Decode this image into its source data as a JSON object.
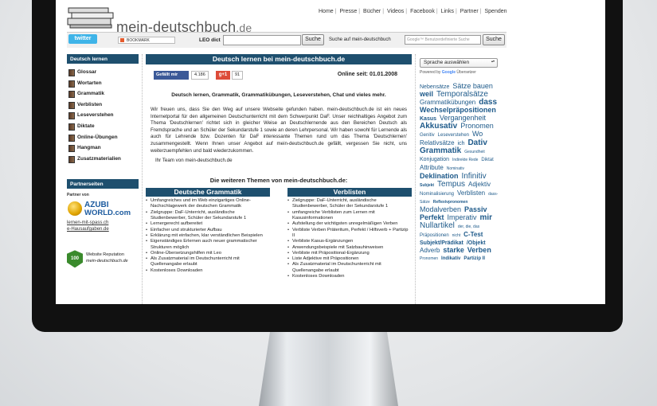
{
  "site": {
    "name": "mein-deutschbuch",
    "tld": ".de"
  },
  "topnav": [
    "Home",
    "Presse",
    "Bücher",
    "Videos",
    "Facebook",
    "Links",
    "Partner",
    "Spenden"
  ],
  "toolbar": {
    "twitter": "twitter",
    "bookmark": "BOOKMARK",
    "leo_label": "LEO dict",
    "search_button": "Suche",
    "site_search_label": "Suche auf mein-deutschbuch",
    "google_placeholder": "Google™ Benutzerdefinierte Suche",
    "search_button2": "Suche"
  },
  "sidebar": {
    "header": "Deutsch lernen",
    "items": [
      "Glossar",
      "Wortarten",
      "Grammatik",
      "Verblisten",
      "Leseverstehen",
      "Diktate",
      "Online-Übungen",
      "Hangman",
      "Zusatzmaterialien"
    ],
    "partner_header": "Partnerseiten",
    "partner_label": "Partner von",
    "azubi_line1": "AZUBI",
    "azubi_line2": "WORLD.com",
    "links": [
      "lernen-mit-spass.ch",
      "e-Hausaufgaben.de"
    ],
    "rep_badge": "100",
    "rep_line1": "Website Reputation",
    "rep_line2": "mein-deutschbuch.de"
  },
  "main": {
    "title": "Deutsch lernen bei mein-deutschbuch.de",
    "fb_label": "Gefällt mir",
    "fb_count": "4.186",
    "gplus_label": "g+1",
    "gplus_count": "91",
    "online_since": "Online seit: 01.01.2008",
    "tagline": "Deutsch lernen, Grammatik, Grammatikübungen, Leseverstehen, Chat und vieles mehr.",
    "intro": "Wir freuen uns, dass Sie den Weg auf unsere Webseite gefunden haben. mein-deutschbuch.de ist ein neues Internetportal für den allgemeinen Deutschunterricht mit dem Schwerpunkt DaF. Unser reichhaltiges Angebot zum Thema 'Deutschlernen' richtet sich in gleicher Weise an Deutschlernende aus den Bereichen Deutsch als Fremdsprache und an Schüler der Sekundarstufe 1 sowie an deren Lehrpersonal. Wir haben sowohl für Lernende als auch für Lehrende bzw. Dozenten für DaF interessante Themen rund um das Thema 'Deutschlernen' zusammengestellt. Wenn Ihnen unser Angebot auf mein-deutschbuch.de gefällt, vergessen Sie nicht, uns weiterzuempfehlen und bald wiederzukommen.",
    "team": "Ihr Team von mein-deutschbuch.de",
    "subtitle": "Die weiteren Themen von mein-deutschbuch.de:",
    "col1": {
      "header": "Deutsche Grammatik",
      "items": [
        "Umfangreiches und im Web einzigartiges Online-Nachschlagewerk der deutschen Grammatik",
        "Zielgruppe: DaF-Unterricht, ausländische Studienbewerber, Schüler der Sekundarstufe 1",
        "Lernergerecht aufbereitet",
        "Einfacher und strukturierter Aufbau",
        "Erklärung mit einfachen, klar verständlichen Beispielen",
        "Eigenständiges Erlernen auch neuer grammatischer Strukturen möglich",
        "Online-Übersetzungshilfen mit Leo",
        "Als Zusatzmaterial im Deutschunterricht mit Quellenangabe erlaubt",
        "Kostenloses Downloaden"
      ]
    },
    "col2": {
      "header": "Verblisten",
      "items": [
        "Zielgruppe: DaF-Unterricht, ausländische Studienbewerber, Schüler der Sekundarstufe 1",
        "umfangreiche Verblisten zum Lernen mit Kasusinformationen",
        "Aufstellung der wichtigsten unregelmäßigen Verben",
        "Verbliste Verben Präteritum, Perfekt / Hilfsverb + Partizip II",
        "Verbliste Kasus-Ergänzungen",
        "Anwendungsbeispiele mit Satzbauhinweisen",
        "Verbliste mit Präpositional-Ergänzung",
        "Liste Adjektive mit Präpositionen",
        "Als Zusatzmaterial im Deutschunterricht mit Quellenangabe erlaubt",
        "Kostenloses Downloaden"
      ]
    }
  },
  "right": {
    "lang_select": "Sprache auswählen",
    "powered": "Powered by",
    "google": "Google",
    "translate": "Übersetzer",
    "cloud": [
      {
        "t": "Nebensätze",
        "s": 7
      },
      {
        "t": "Sätze bauen",
        "s": 9
      },
      {
        "t": "weil",
        "s": 9,
        "b": true
      },
      {
        "t": "Temporalsätze",
        "s": 10
      },
      {
        "t": "Grammatikübungen",
        "s": 8
      },
      {
        "t": "dass",
        "s": 10,
        "b": true
      },
      {
        "t": "Wechselpräpositionen",
        "s": 9,
        "b": true
      },
      {
        "t": "Kasus",
        "s": 7,
        "b": true
      },
      {
        "t": "Vergangenheit",
        "s": 9
      },
      {
        "t": "Akkusativ",
        "s": 10,
        "b": true
      },
      {
        "t": "Pronomen",
        "s": 9
      },
      {
        "t": "Genitiv",
        "s": 6
      },
      {
        "t": "Leseverstehen",
        "s": 6
      },
      {
        "t": "Wo",
        "s": 9
      },
      {
        "t": "Relativsätze",
        "s": 8
      },
      {
        "t": "ich",
        "s": 7
      },
      {
        "t": "Dativ",
        "s": 10,
        "b": true
      },
      {
        "t": "Grammatik",
        "s": 10,
        "b": true
      },
      {
        "t": "Gesundheit",
        "s": 5
      },
      {
        "t": "Konjugation",
        "s": 7
      },
      {
        "t": "Indirekte Rede",
        "s": 5
      },
      {
        "t": "Diktat",
        "s": 6
      },
      {
        "t": "Attribute",
        "s": 8
      },
      {
        "t": "Nominativ",
        "s": 5
      },
      {
        "t": "Deklination",
        "s": 9,
        "b": true
      },
      {
        "t": "Infinitiv",
        "s": 10
      },
      {
        "t": "Subjekt",
        "s": 5,
        "b": true
      },
      {
        "t": "Tempus",
        "s": 10
      },
      {
        "t": "Adjektiv",
        "s": 8
      },
      {
        "t": "Nominalisierung",
        "s": 6
      },
      {
        "t": "Verblisten",
        "s": 8
      },
      {
        "t": "dass-Sätze",
        "s": 5
      },
      {
        "t": "Reflexivpronomen",
        "s": 5,
        "b": true
      },
      {
        "t": "Modalverben",
        "s": 9
      },
      {
        "t": "Passiv",
        "s": 9,
        "b": true
      },
      {
        "t": "Perfekt",
        "s": 9,
        "b": true
      },
      {
        "t": "Imperativ",
        "s": 9
      },
      {
        "t": "mir",
        "s": 10,
        "b": true
      },
      {
        "t": "Nullartikel",
        "s": 10
      },
      {
        "t": "der, die, das",
        "s": 5
      },
      {
        "t": "Präpositionen",
        "s": 6
      },
      {
        "t": "nicht",
        "s": 5
      },
      {
        "t": "C-Test",
        "s": 8,
        "b": true
      },
      {
        "t": "Subjekt/Prädikat",
        "s": 7,
        "b": true
      },
      {
        "t": "/Objekt",
        "s": 7,
        "b": true
      },
      {
        "t": "Adverb",
        "s": 8
      },
      {
        "t": "starke",
        "s": 9,
        "b": true
      },
      {
        "t": "Verben",
        "s": 9,
        "b": true
      },
      {
        "t": "Pronomen",
        "s": 5
      },
      {
        "t": "Indikativ",
        "s": 6,
        "b": true
      },
      {
        "t": "Partizip II",
        "s": 6,
        "b": true
      }
    ]
  },
  "colors": {
    "accent": "#1e4f6e",
    "link": "#1e5a8a",
    "bezel": "#111111"
  }
}
